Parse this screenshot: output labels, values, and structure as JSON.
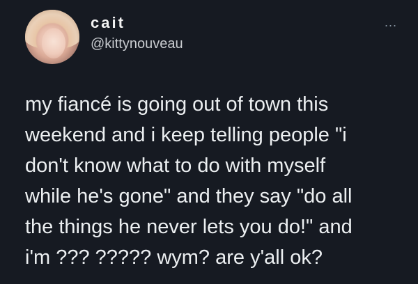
{
  "tweet": {
    "display_name": "cait",
    "handle": "@kittynouveau",
    "more_label": "...",
    "lines": [
      "my fiancé is going out of town this",
      "weekend and i keep telling people \"i",
      "don't know what to do with myself",
      "while he's gone\" and they say \"do all",
      "the things he never lets you do!\" and",
      "i'm ??? ????? wym? are y'all ok?"
    ]
  }
}
